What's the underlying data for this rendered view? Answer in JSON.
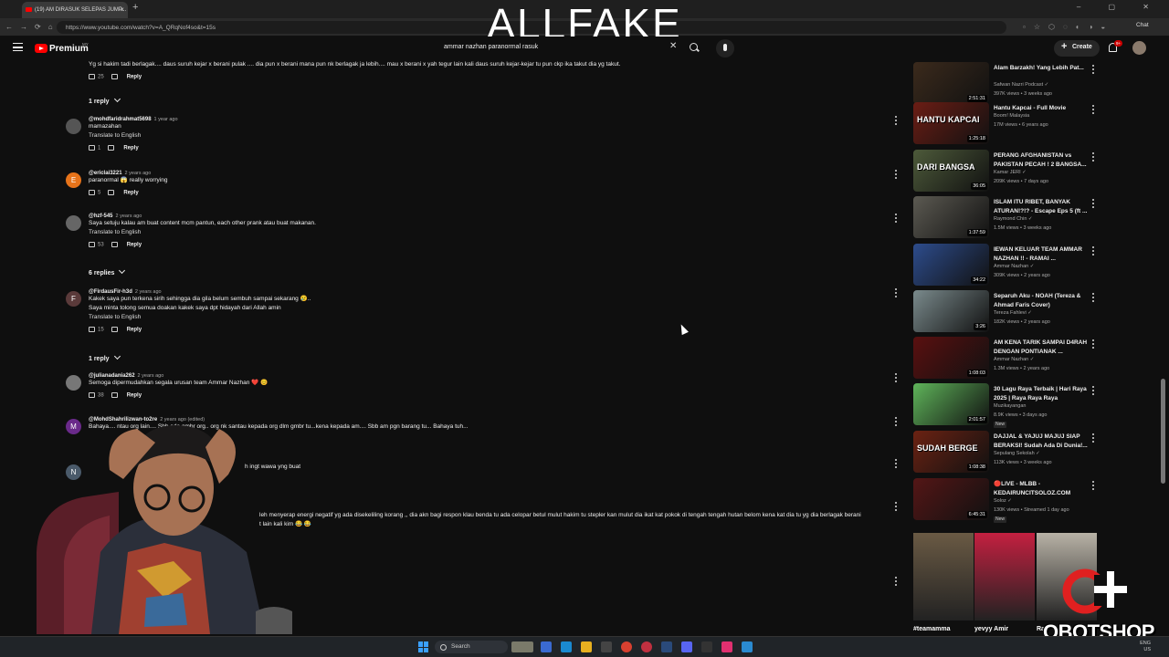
{
  "browser": {
    "tab_title": "(19) AM DIRASUK SELEPAS JUMP...",
    "url": "https://www.youtube.com/watch?v=A_QRqNof4so&t=15s",
    "chat_label": "Chat",
    "window_controls": "–  ▢  ✕"
  },
  "overlay_title": "ALLFAKE",
  "header": {
    "brand": "Premium",
    "brand_sup": "MY",
    "search_value": "ammar nazhan paranormal rasuk",
    "create_label": "Create",
    "notif_count": "9+"
  },
  "comments": [
    {
      "handle": "",
      "date": "",
      "lines": [
        "Yg si hakim tadi berlagak.... daus suruh kejar x berani pulak .... dia pun x berani mana pun nk berlagak ja lebih.... mau x berani x yah tegur lain kali daus suruh kejar-kejar tu pun ckp ika takut dia yg takut."
      ],
      "translate": "",
      "likes": "25",
      "reply": "Reply",
      "replies": "1 reply"
    },
    {
      "handle": "@mohdfaridrahmat5698",
      "date": "1 year ago",
      "lines": [
        "mamazahan"
      ],
      "translate": "Translate to English",
      "likes": "1",
      "reply": "Reply",
      "replies": ""
    },
    {
      "handle": "@ericlai3221",
      "date": "2 years ago",
      "lines": [
        "paranormal 😱 really worrying"
      ],
      "translate": "",
      "likes": "5",
      "reply": "Reply",
      "replies": ""
    },
    {
      "handle": "@hzf-545",
      "date": "2 years ago",
      "lines": [
        "Saya setuju kalau am buat content mcm pantun, each other  prank atau buat makanan."
      ],
      "translate": "Translate to English",
      "likes": "53",
      "reply": "Reply",
      "replies": "6 replies"
    },
    {
      "handle": "@FirdausFir-h3d",
      "date": "2 years ago",
      "lines": [
        "Kakek saya pun terkena sirih sehingga dia gila belum sembuh sampai sekarang 😢..",
        "Saya minta tolong semua doakan kakek saya dpt hidayah dari Allah amin"
      ],
      "translate": "Translate to English",
      "likes": "15",
      "reply": "Reply",
      "replies": "1 reply"
    },
    {
      "handle": "@julianadania262",
      "date": "2 years ago",
      "lines": [
        "Semoga dipermudahkan segala urusan team Ammar Nazhan ❤️ 😊"
      ],
      "translate": "",
      "likes": "38",
      "reply": "Reply",
      "replies": ""
    },
    {
      "handle": "@MohdShahrilizwan-to2re",
      "date": "2 years ago (edited)",
      "lines": [
        "Bahaya.... ntau org lain.... Sbb ada gmbr org.. org nk santau kepada org dlm gmbr tu...kena kepada am.... Sbb am pgn barang tu... Bahaya tuh..."
      ],
      "translate": "",
      "likes": "",
      "reply": "",
      "replies": ""
    },
    {
      "handle": "",
      "date": "",
      "lines": [
        "h ingt wawa yng buat"
      ],
      "translate": "",
      "likes": "",
      "reply": "",
      "replies": ""
    },
    {
      "handle": "",
      "date": "",
      "lines": [
        "leh menyerap energi negatif yg ada disekeliling korang ,, dia akn bagi respon klau benda tu ada celopar betul mulut hakim tu stepler kan mulut dia ikat kat pokok di tengah tengah hutan belom kena kat dia tu yg dia berlagak berani",
        "t lain kali kim 😂 😂"
      ],
      "translate": "",
      "likes": "",
      "reply": "",
      "replies": ""
    }
  ],
  "sidebar": [
    {
      "title": "Alam Barzakh! Yang Lebih Pat...",
      "channel": "Safwan Nazri Podcast ✓",
      "meta": "397K views • 3 weeks ago",
      "duration": "2:51:31",
      "thumb_text": "",
      "thumb_color": "#3b2a1c",
      "is_new": ""
    },
    {
      "title": "Hantu Kapcai - Full Movie",
      "channel": "Boom! Malaysia",
      "meta": "17M views • 6 years ago",
      "duration": "1:25:18",
      "thumb_text": "HANTU KAPCAI",
      "thumb_color": "#6b1d14",
      "is_new": ""
    },
    {
      "title": "PERANG AFGHANISTAN vs PAKISTAN PECAH ! 2 BANGSA...",
      "channel": "Kamar JERI ✓",
      "meta": "209K views • 7 days ago",
      "duration": "36:05",
      "thumb_text": "DARI BANGSA",
      "thumb_color": "#4d5a3a",
      "is_new": ""
    },
    {
      "title": "ISLAM ITU RIBET, BANYAK ATURAN!?!? - Escape Eps 5 (ft ...",
      "channel": "Raymond Chin ✓",
      "meta": "1.5M views • 3 weeks ago",
      "duration": "1:37:59",
      "thumb_text": "",
      "thumb_color": "#5c5a52",
      "is_new": ""
    },
    {
      "title": "IEWAN KELUAR TEAM AMMAR NAZHAN !! - RAMAI ...",
      "channel": "Ammar Nazhan ✓",
      "meta": "309K views • 2 years ago",
      "duration": "34:22",
      "thumb_text": "",
      "thumb_color": "#2d4c8c",
      "is_new": ""
    },
    {
      "title": "Separuh Aku - NOAH (Tereza & Ahmad Faris Cover)",
      "channel": "Tereza Fahlevi ✓",
      "meta": "182K views • 2 years ago",
      "duration": "3:26",
      "thumb_text": "",
      "thumb_color": "#7a8a8c",
      "is_new": ""
    },
    {
      "title": "AM KENA TARIK SAMPAI D4RAH DENGAN PONTIANAK ...",
      "channel": "Ammar Nazhan ✓",
      "meta": "1.3M views • 2 years ago",
      "duration": "1:08:03",
      "thumb_text": "",
      "thumb_color": "#5a1010",
      "is_new": ""
    },
    {
      "title": "30 Lagu Raya Terbaik | Hari Raya 2025 | Raya Raya Raya",
      "channel": "Muzikayangan",
      "meta": "8.9K views • 3 days ago",
      "duration": "2:01:57",
      "thumb_text": "",
      "thumb_color": "#5fb45a",
      "is_new": "New"
    },
    {
      "title": "DAJJAL & YAJUJ MAJUJ SIAP BERAKSI! Sudah Ada Di Dunia!...",
      "channel": "Sepulang Sekolah ✓",
      "meta": "113K views • 3 weeks ago",
      "duration": "1:08:38",
      "thumb_text": "SUDAH BERGE",
      "thumb_color": "#6b2212",
      "is_new": ""
    },
    {
      "title": "🔴LIVE - MLBB - KEDAIRUNCITSOLOZ.COM",
      "channel": "Soloz ✓",
      "meta": "130K views • Streamed 1 day ago",
      "duration": "6:45:31",
      "thumb_text": "",
      "thumb_color": "#541616",
      "is_new": "New"
    }
  ],
  "shorts": [
    {
      "label": "#teamamma",
      "color": "#6a5a44"
    },
    {
      "label": "yevyy Amir",
      "color": "#c42040"
    },
    {
      "label": "Ra",
      "color": "#b8b2a6"
    }
  ],
  "watermark": "OBOTSHOP",
  "taskbar": {
    "search_label": "Search",
    "tray_line1": "ENG",
    "tray_line2": "US"
  },
  "colors": {
    "bg": "#0f0f0f",
    "accent": "#ff0000"
  }
}
